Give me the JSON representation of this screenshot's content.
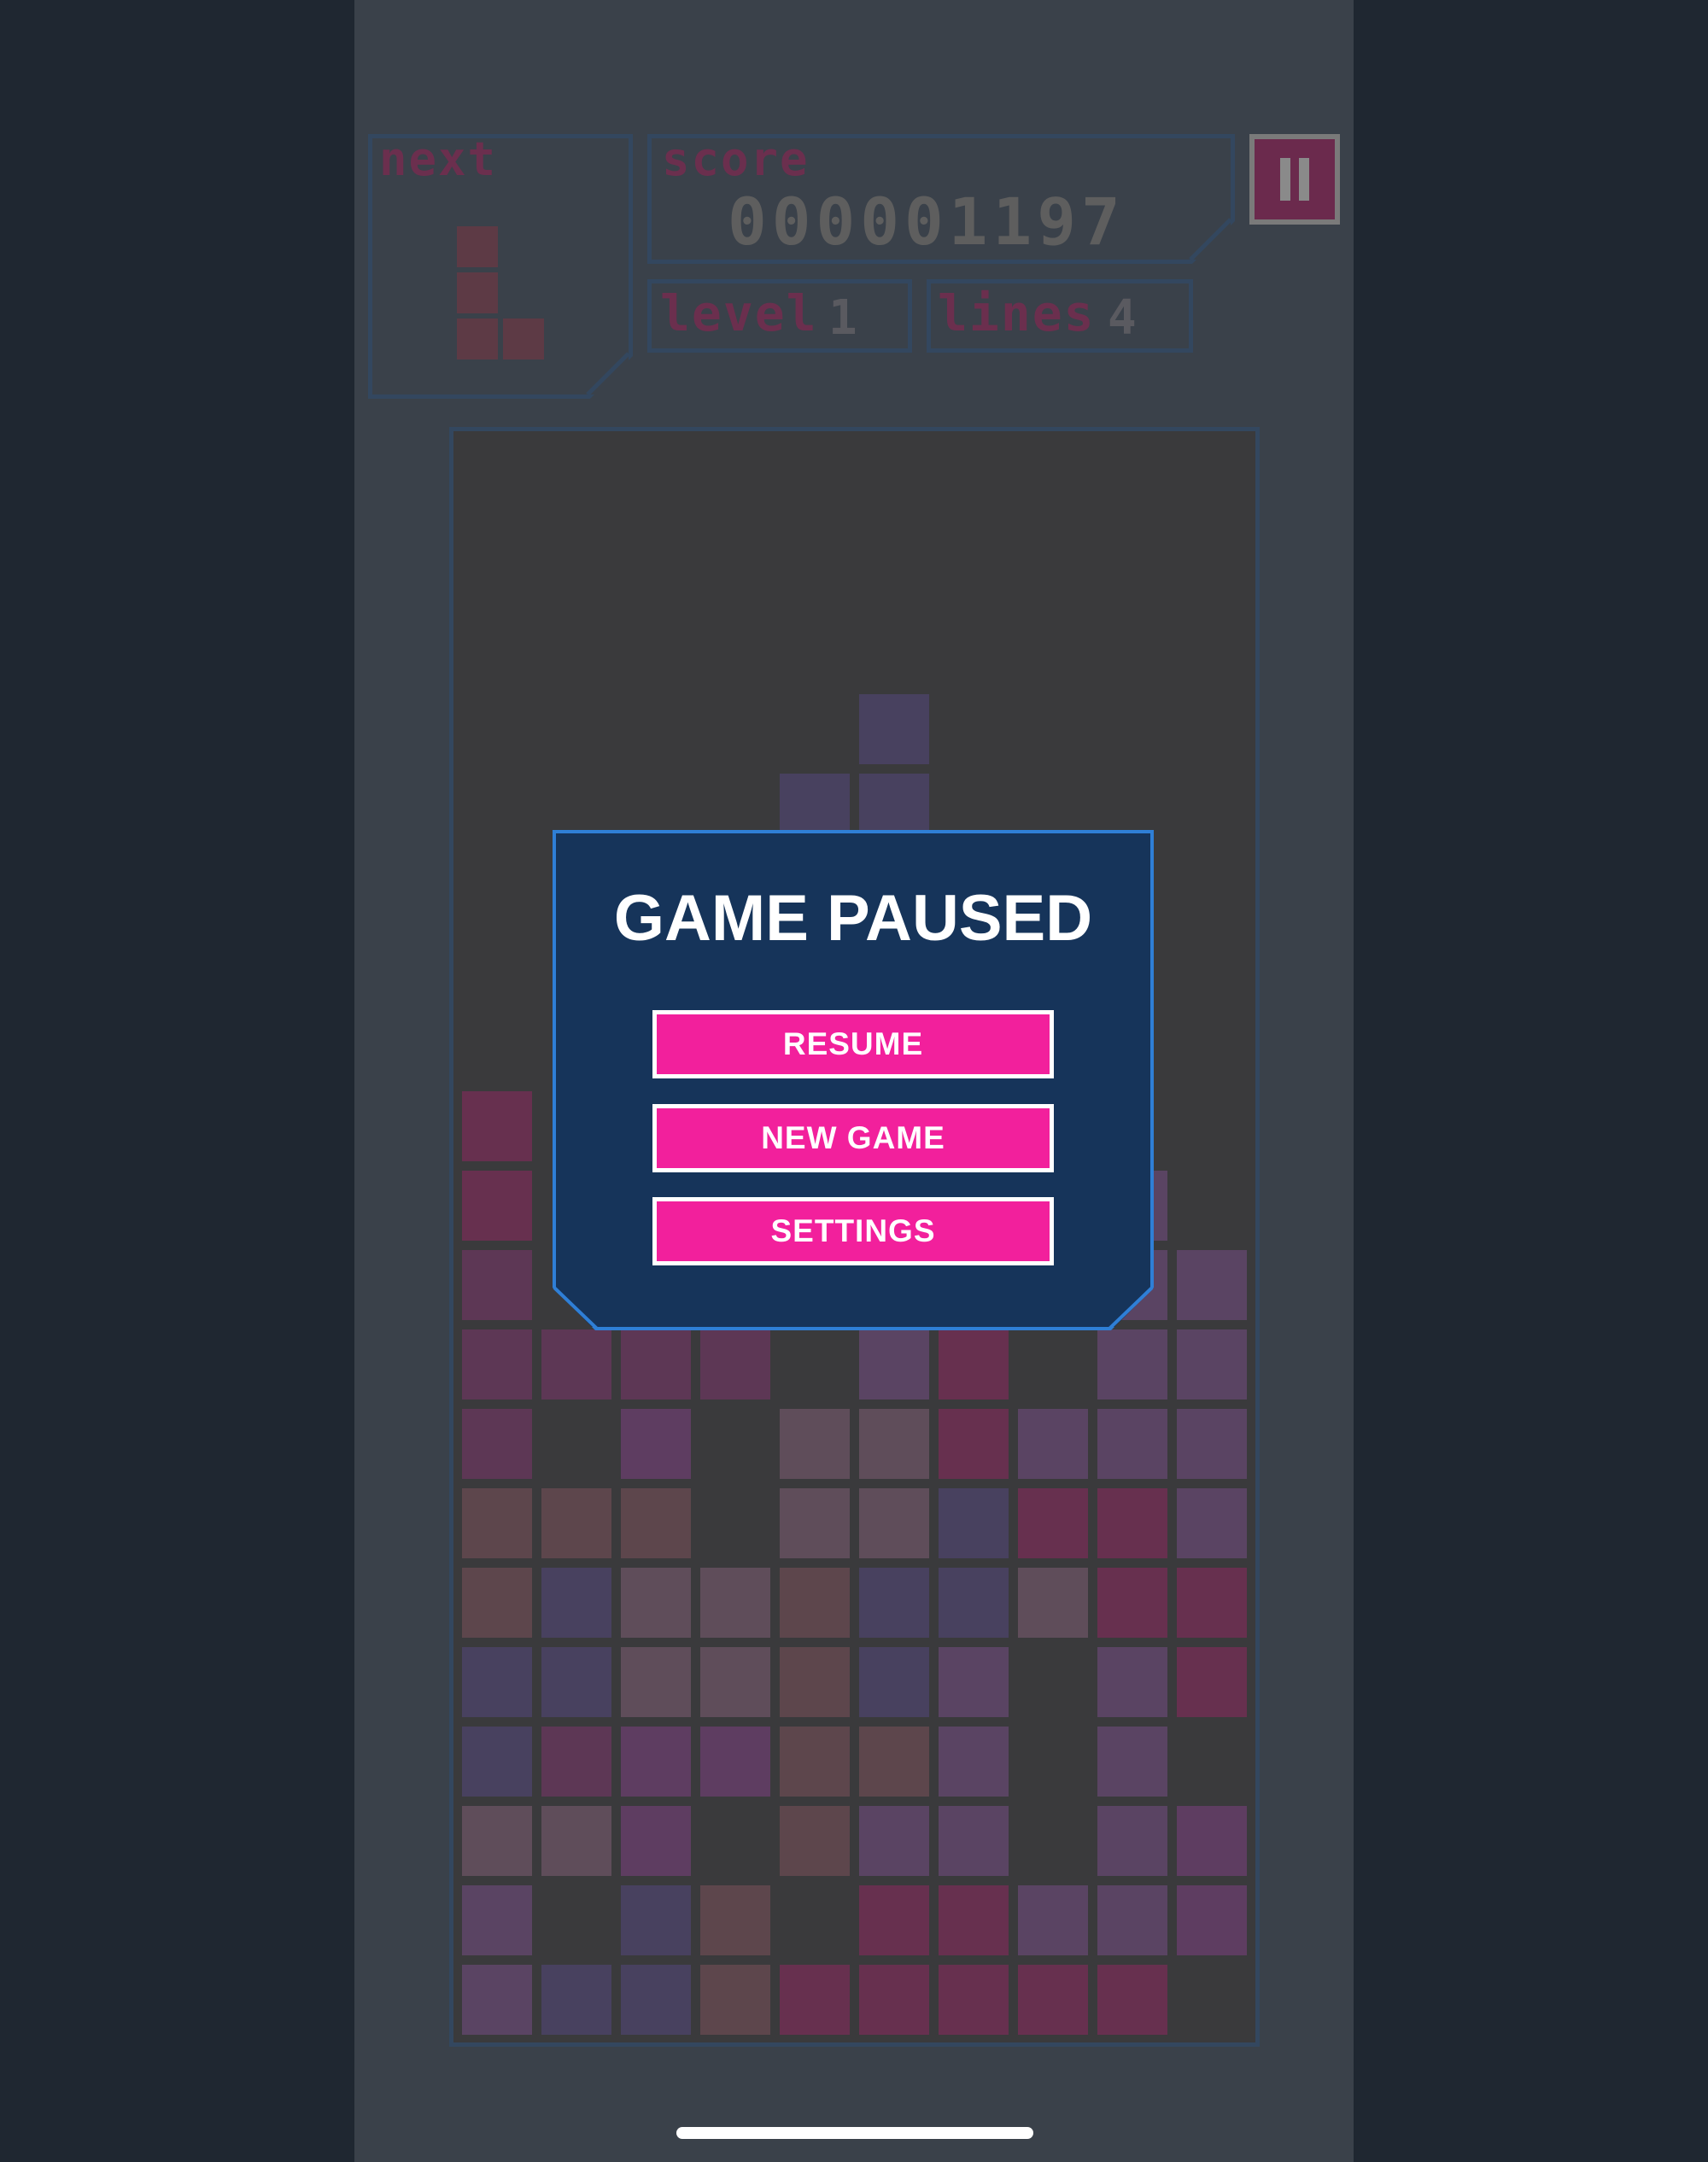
{
  "hud": {
    "next_label": "next",
    "score_label": "score",
    "score_value": "000001197",
    "level_label": "level",
    "level_value": "1",
    "lines_label": "lines",
    "lines_value": "4",
    "pause_icon": "pause-icon"
  },
  "next_piece": {
    "shape": "L",
    "color": "#5d3a45"
  },
  "board": {
    "columns": 10,
    "rows": 20,
    "active_piece_color": "#48415f",
    "palette": {
      "magenta": "#67304f",
      "plum": "#5d3755",
      "mauve": "#5f4d5a",
      "brown": "#5d464c",
      "indigo": "#48415f",
      "violet": "#5a4463",
      "purple": "#5e3d61"
    }
  },
  "modal": {
    "title": "GAME PAUSED",
    "buttons": [
      "RESUME",
      "NEW GAME",
      "SETTINGS"
    ],
    "background": "#16345a",
    "border_color": "#2f7fd6",
    "button_color": "#f2209c"
  }
}
